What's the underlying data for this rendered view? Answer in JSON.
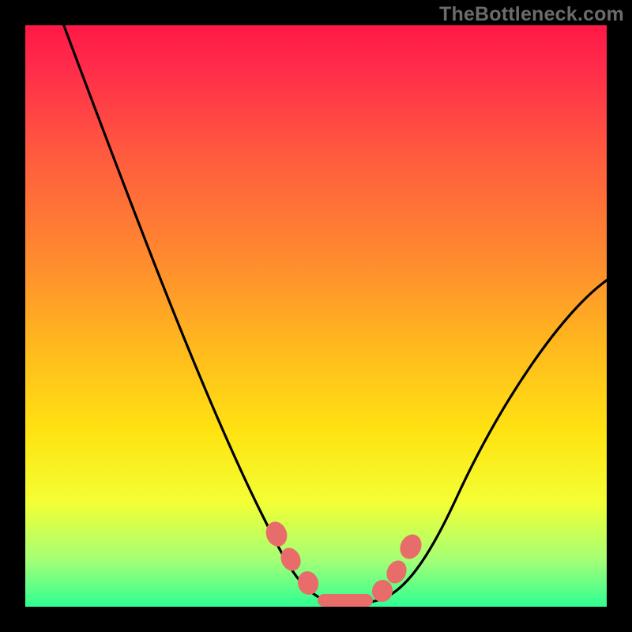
{
  "watermark": "TheBottleneck.com",
  "chart_data": {
    "type": "line",
    "title": "",
    "xlabel": "",
    "ylabel": "",
    "xlim": [
      0,
      100
    ],
    "ylim": [
      0,
      100
    ],
    "x": [
      0,
      5,
      10,
      15,
      20,
      25,
      30,
      35,
      40,
      42,
      45,
      48,
      50,
      52,
      55,
      58,
      60,
      63,
      65,
      70,
      75,
      80,
      85,
      90,
      95,
      100
    ],
    "values": [
      100,
      90,
      80,
      70,
      60,
      50,
      40,
      30,
      20,
      14,
      8,
      3,
      1,
      0,
      0,
      0,
      1,
      4,
      8,
      14,
      22,
      30,
      38,
      45,
      51,
      56
    ],
    "markers": {
      "x": [
        42,
        44,
        47,
        50,
        53,
        56,
        59,
        61,
        63
      ],
      "y": [
        12,
        8,
        3,
        1,
        0,
        0,
        1,
        4,
        10
      ],
      "color": "#e86d6a",
      "shape": "rounded-rect"
    },
    "background": "red-yellow-green vertical gradient",
    "curve_color": "#000000"
  }
}
